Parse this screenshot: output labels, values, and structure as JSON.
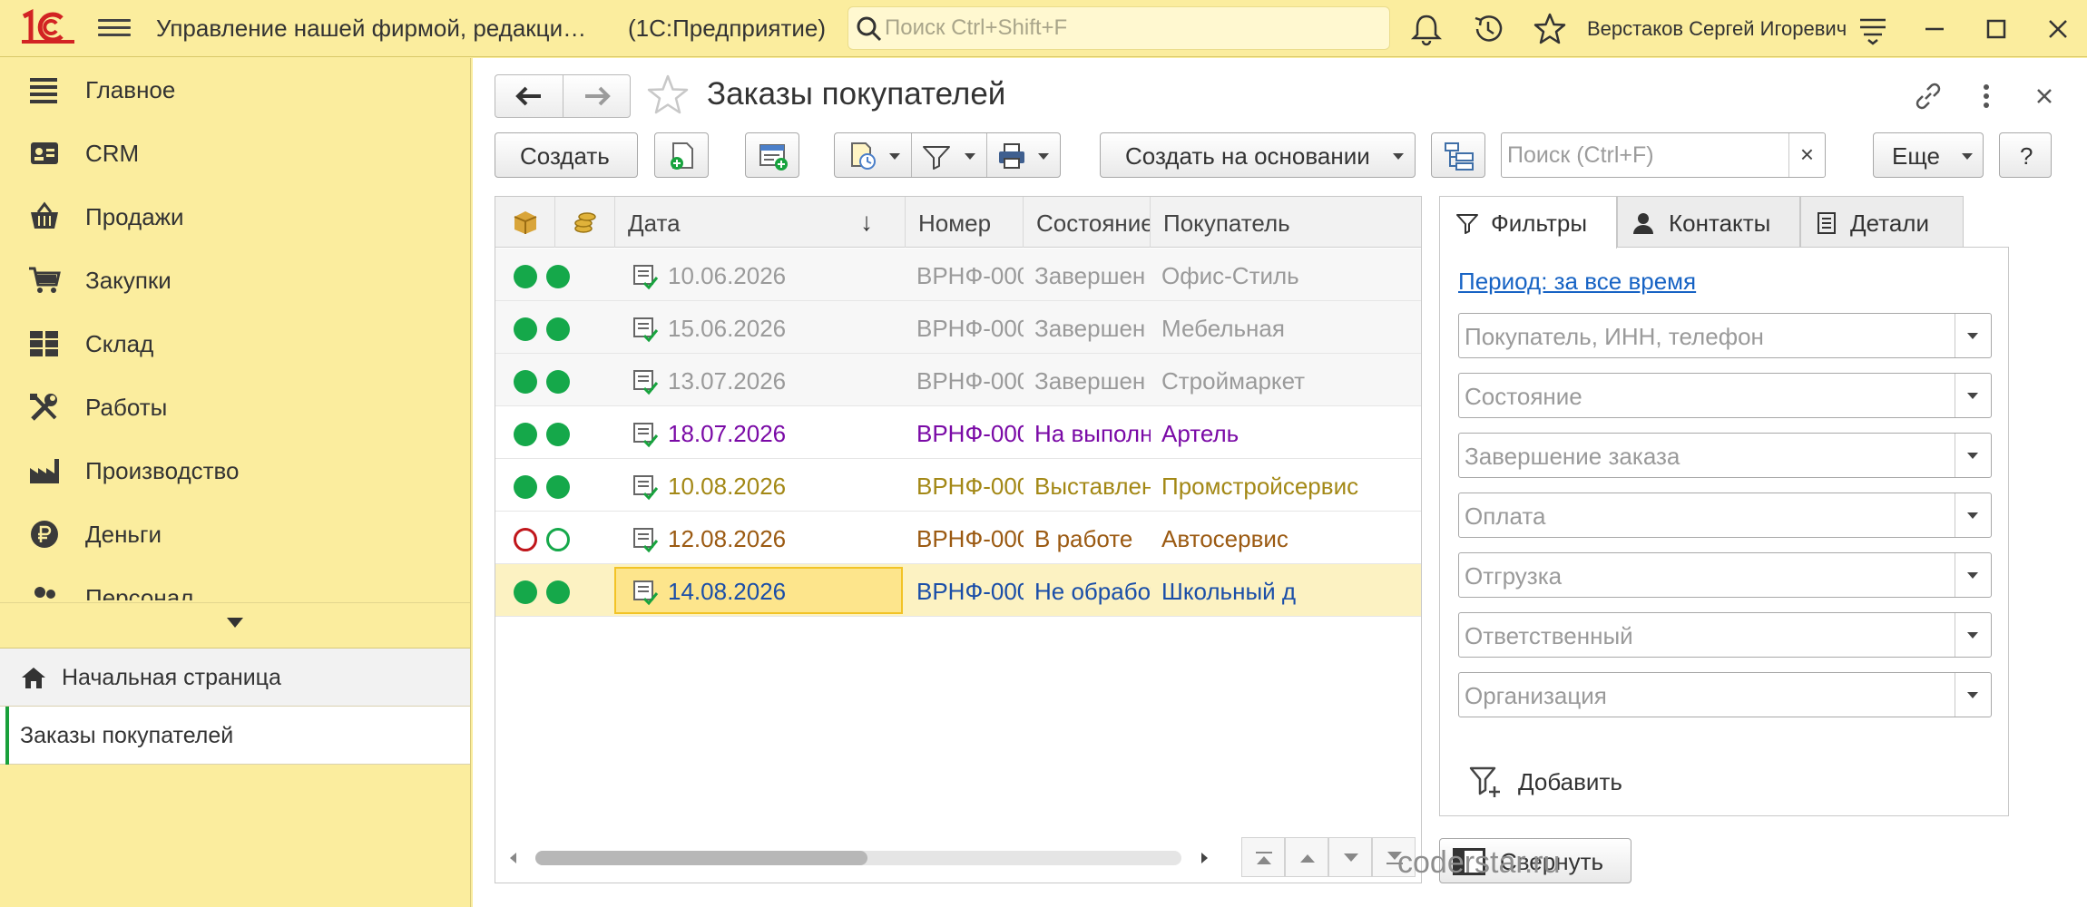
{
  "app": {
    "logo_text": "1С",
    "title": "Управление нашей фирмой, редакци…",
    "platform": "(1С:Предприятие)",
    "search_placeholder": "Поиск Ctrl+Shift+F",
    "user": "Верстаков Сергей Игоревич"
  },
  "sidebar": {
    "items": [
      {
        "label": "Главное",
        "icon": "list-lines-icon"
      },
      {
        "label": "CRM",
        "icon": "contact-card-icon"
      },
      {
        "label": "Продажи",
        "icon": "store-basket-icon"
      },
      {
        "label": "Закупки",
        "icon": "shopping-cart-icon"
      },
      {
        "label": "Склад",
        "icon": "warehouse-grid-icon"
      },
      {
        "label": "Работы",
        "icon": "tools-icon"
      },
      {
        "label": "Производство",
        "icon": "factory-icon"
      },
      {
        "label": "Деньги",
        "icon": "ruble-coin-icon"
      },
      {
        "label": "Персонал",
        "icon": "people-icon"
      }
    ],
    "open_pages": [
      {
        "label": "Начальная страница",
        "icon": "home-icon",
        "active": false
      },
      {
        "label": "Заказы покупателей",
        "active": true
      }
    ]
  },
  "form": {
    "title": "Заказы покупателей",
    "toolbar": {
      "create": "Создать",
      "create_based_on": "Создать на основании",
      "search_placeholder": "Поиск (Ctrl+F)",
      "search_clear": "×",
      "more": "Еще",
      "help": "?"
    },
    "table": {
      "columns": [
        "",
        "",
        "Дата",
        "Номер",
        "Состояние",
        "Покупатель"
      ],
      "sort_indicator": "↓",
      "rows": [
        {
          "status1": "filled",
          "status2": "filled",
          "date": "10.06.2026",
          "number": "ВРНФ-000…",
          "state": "Завершен",
          "customer": "Офис-Стиль",
          "color": "#9a9a9a"
        },
        {
          "status1": "filled",
          "status2": "filled",
          "date": "15.06.2026",
          "number": "ВРНФ-000…",
          "state": "Завершен",
          "customer": "Мебельная",
          "color": "#9a9a9a"
        },
        {
          "status1": "filled",
          "status2": "filled",
          "date": "13.07.2026",
          "number": "ВРНФ-000…",
          "state": "Завершен",
          "customer": "Строймаркет",
          "color": "#9a9a9a"
        },
        {
          "status1": "filled",
          "status2": "filled",
          "date": "18.07.2026",
          "number": "ВРНФ-000…",
          "state": "На выполн…",
          "customer": "Артель",
          "color": "#7a0aa6"
        },
        {
          "status1": "filled",
          "status2": "filled",
          "date": "10.08.2026",
          "number": "ВРНФ-000…",
          "state": "Выставлен …",
          "customer": "Промстройсервис",
          "color": "#a38816"
        },
        {
          "status1": "ring-red",
          "status2": "ring-green",
          "date": "12.08.2026",
          "number": "ВРНФ-000…",
          "state": "В работе",
          "customer": "Автосервис",
          "color": "#9b5a12"
        },
        {
          "status1": "filled",
          "status2": "filled",
          "date": "14.08.2026",
          "number": "ВРНФ-000…",
          "state": "Не обработ…",
          "customer": "Школьный д",
          "color": "#1a4ea8",
          "selected": true
        }
      ]
    },
    "filters": {
      "tabs": [
        "Фильтры",
        "Контакты",
        "Детали"
      ],
      "active_tab": 0,
      "period": "Период: за все время",
      "fields": [
        "Покупатель, ИНН, телефон",
        "Состояние",
        "Завершение заказа",
        "Оплата",
        "Отгрузка",
        "Ответственный",
        "Организация"
      ],
      "add": "Добавить",
      "collapse": "Свернуть"
    }
  },
  "watermark": "coderstar.ru",
  "colors": {
    "panel_yellow": "#fbed9e",
    "status_green": "#15a84a",
    "status_red": "#c0161b",
    "link_blue": "#1763c4",
    "selection": "#fde58c"
  }
}
